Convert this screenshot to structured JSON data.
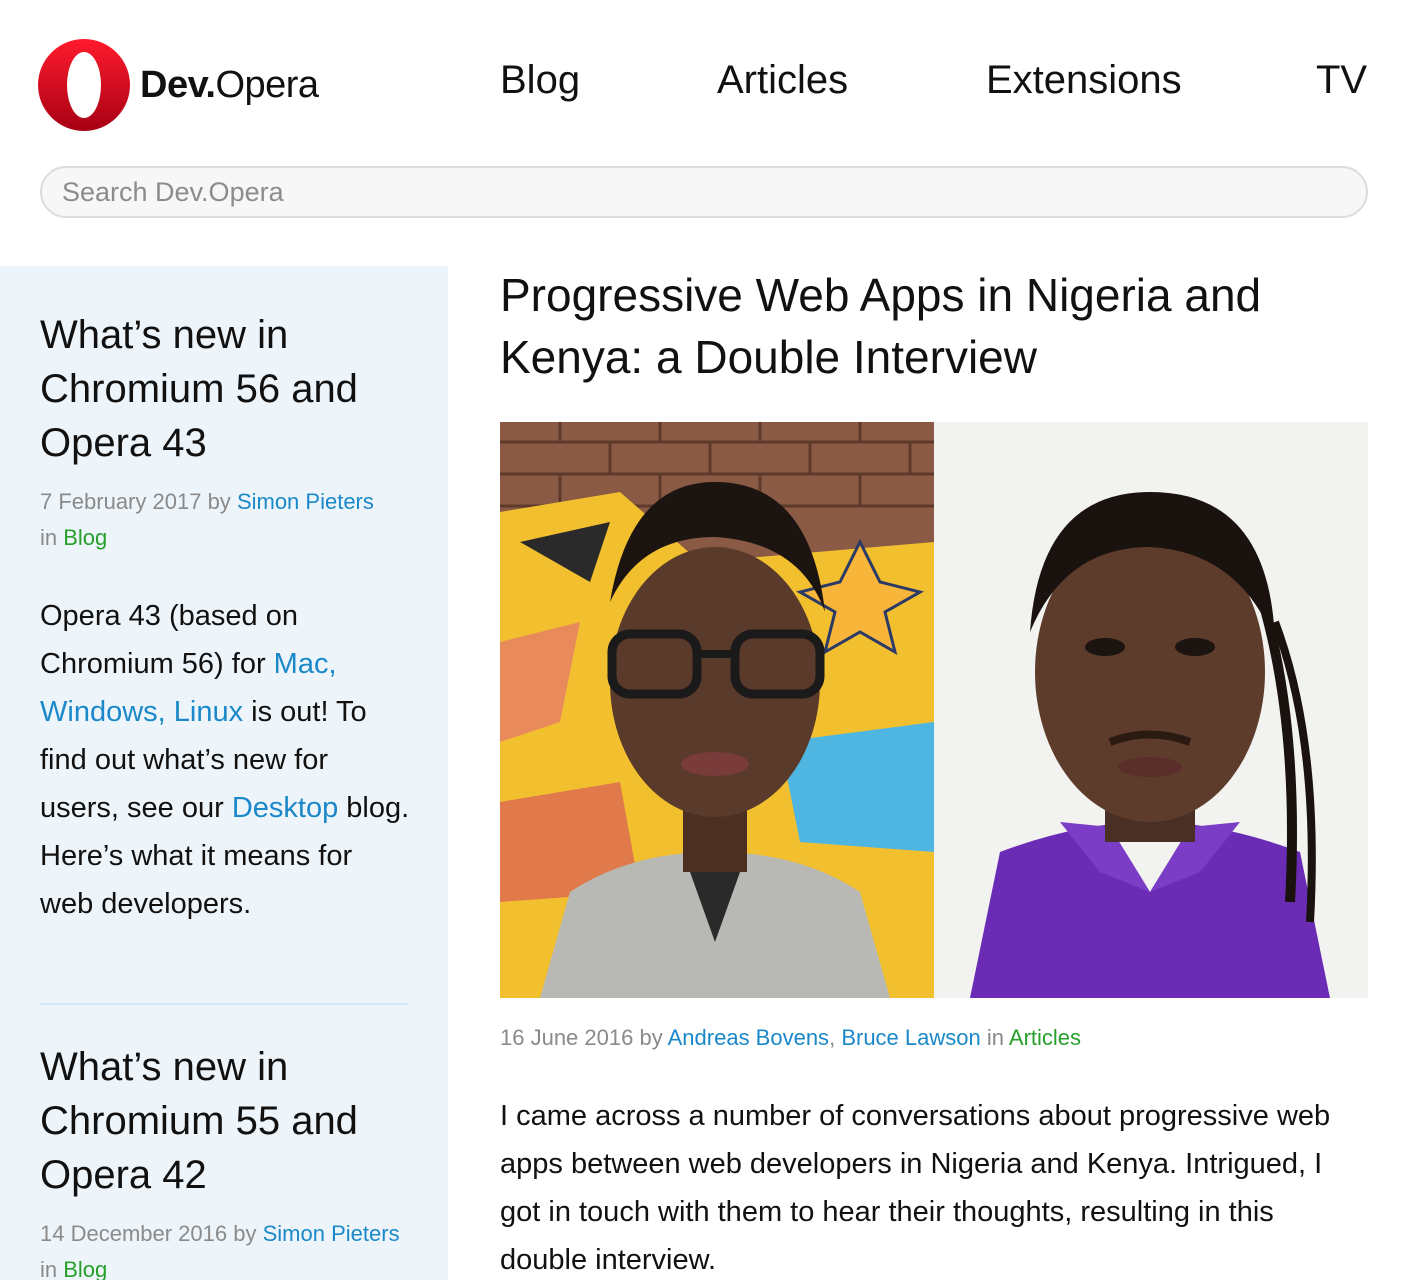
{
  "header": {
    "logo_dev": "Dev.",
    "logo_opera": "Opera",
    "nav": [
      "Blog",
      "Articles",
      "Extensions",
      "TV"
    ]
  },
  "search": {
    "placeholder": "Search Dev.Opera"
  },
  "sidebar": {
    "posts": [
      {
        "title": "What’s new in Chromium 56 and Opera 43",
        "date": "7 February 2017",
        "by": "by",
        "author": "Simon Pieters",
        "in": "in",
        "category": "Blog",
        "body": {
          "t1": "Opera 43 (based on Chromium 56) for ",
          "l1": "Mac, Windows, Linux",
          "t2": " is out! To find out what’s new for users, see our ",
          "l2": "Desktop",
          "t3": " blog. Here’s what it means for web developers."
        }
      },
      {
        "title": "What’s new in Chromium 55 and Opera 42",
        "date": "14 December 2016",
        "by": "by",
        "author": "Simon Pieters",
        "in": "in",
        "category": "Blog"
      }
    ]
  },
  "article": {
    "title": "Progressive Web Apps in Nigeria and Kenya: a Double Interview",
    "date": "16 June 2016",
    "by": "by",
    "author1": "Andreas Bovens",
    "separator": ",",
    "author2": "Bruce Lawson",
    "in": "in",
    "category": "Articles",
    "body": "I came across a number of conversations about progressive web apps between web developers in Nigeria and Kenya. Intrigued, I got in touch with them to hear their thoughts, resulting in this double interview."
  },
  "colors": {
    "link": "#1a88c9",
    "category": "#26a02a",
    "sidebar_bg": "#eef5fa",
    "brand": "#d8091b"
  }
}
